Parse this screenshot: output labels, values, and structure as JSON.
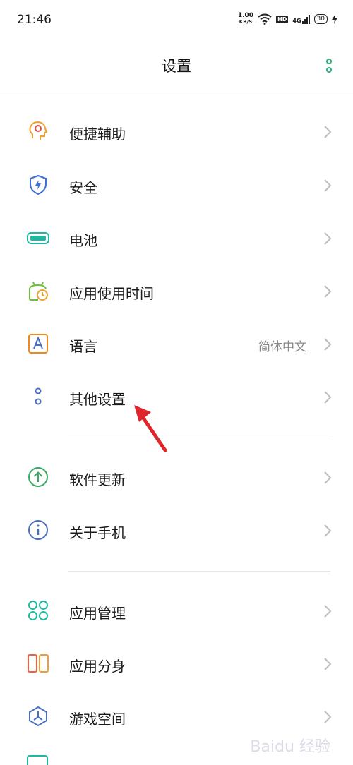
{
  "status_bar": {
    "time": "21:46",
    "net_speed_value": "1.00",
    "net_speed_unit": "KB/S",
    "hd": "HD",
    "signal": "4G",
    "battery": "30"
  },
  "header": {
    "title": "设置"
  },
  "items": [
    {
      "label": "便捷辅助",
      "value": "",
      "icon": "accessibility-icon",
      "color": "#f0a030"
    },
    {
      "label": "安全",
      "value": "",
      "icon": "shield-icon",
      "color": "#3a6fd8"
    },
    {
      "label": "电池",
      "value": "",
      "icon": "battery-icon",
      "color": "#20b8a0"
    },
    {
      "label": "应用使用时间",
      "value": "",
      "icon": "screen-time-icon",
      "color": "#6cbf3a"
    },
    {
      "label": "语言",
      "value": "简体中文",
      "icon": "language-icon",
      "color": "#f08a20"
    },
    {
      "label": "其他设置",
      "value": "",
      "icon": "other-settings-icon",
      "color": "#4a6fc0"
    },
    {
      "label": "软件更新",
      "value": "",
      "icon": "update-icon",
      "color": "#3aa860"
    },
    {
      "label": "关于手机",
      "value": "",
      "icon": "info-icon",
      "color": "#4a6fc0"
    },
    {
      "label": "应用管理",
      "value": "",
      "icon": "app-management-icon",
      "color": "#20b8a0"
    },
    {
      "label": "应用分身",
      "value": "",
      "icon": "app-clone-icon",
      "color": "#f06040"
    },
    {
      "label": "游戏空间",
      "value": "",
      "icon": "game-space-icon",
      "color": "#4a6fc0"
    }
  ],
  "colors": {
    "accent": "#2db37c",
    "arrow": "#e0262a"
  }
}
